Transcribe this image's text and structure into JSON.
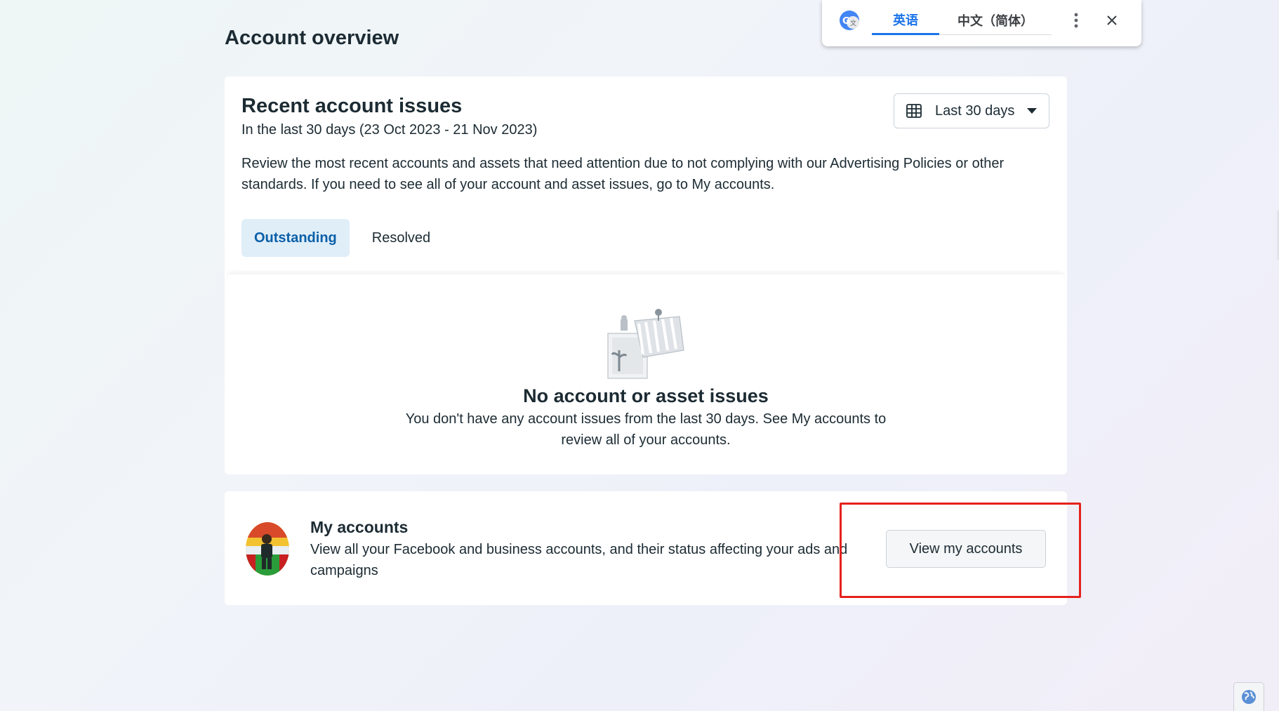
{
  "page": {
    "title": "Account overview"
  },
  "issues": {
    "title": "Recent account issues",
    "subtitle": "In the last 30 days (23 Oct 2023 - 21 Nov 2023)",
    "description": "Review the most recent accounts and assets that need attention due to not complying with our Advertising Policies or other standards. If you need to see all of your account and asset issues, go to My accounts.",
    "date_range": {
      "selected": "Last 30 days",
      "icon": "calendar-icon"
    },
    "tabs": [
      {
        "label": "Outstanding",
        "active": true
      },
      {
        "label": "Resolved",
        "active": false
      }
    ],
    "empty_state": {
      "title": "No account or asset issues",
      "text": "You don't have any account issues from the last 30 days. See My accounts to review all of your accounts."
    }
  },
  "my_accounts": {
    "title": "My accounts",
    "description": "View all your Facebook and business accounts, and their status affecting your ads and campaigns",
    "button_label": "View my accounts"
  },
  "translate_bar": {
    "tabs": [
      {
        "label": "英语",
        "active": true
      },
      {
        "label": "中文（简体）",
        "active": false
      }
    ],
    "logo_icon": "google-translate-icon",
    "more_icon": "more-vert-icon",
    "close_icon": "close-icon"
  },
  "colors": {
    "accent_tab_bg": "#e0eef8",
    "accent_tab_text": "#0a5fa8",
    "highlight_border": "#e5211d",
    "translate_active": "#1a73e8"
  }
}
